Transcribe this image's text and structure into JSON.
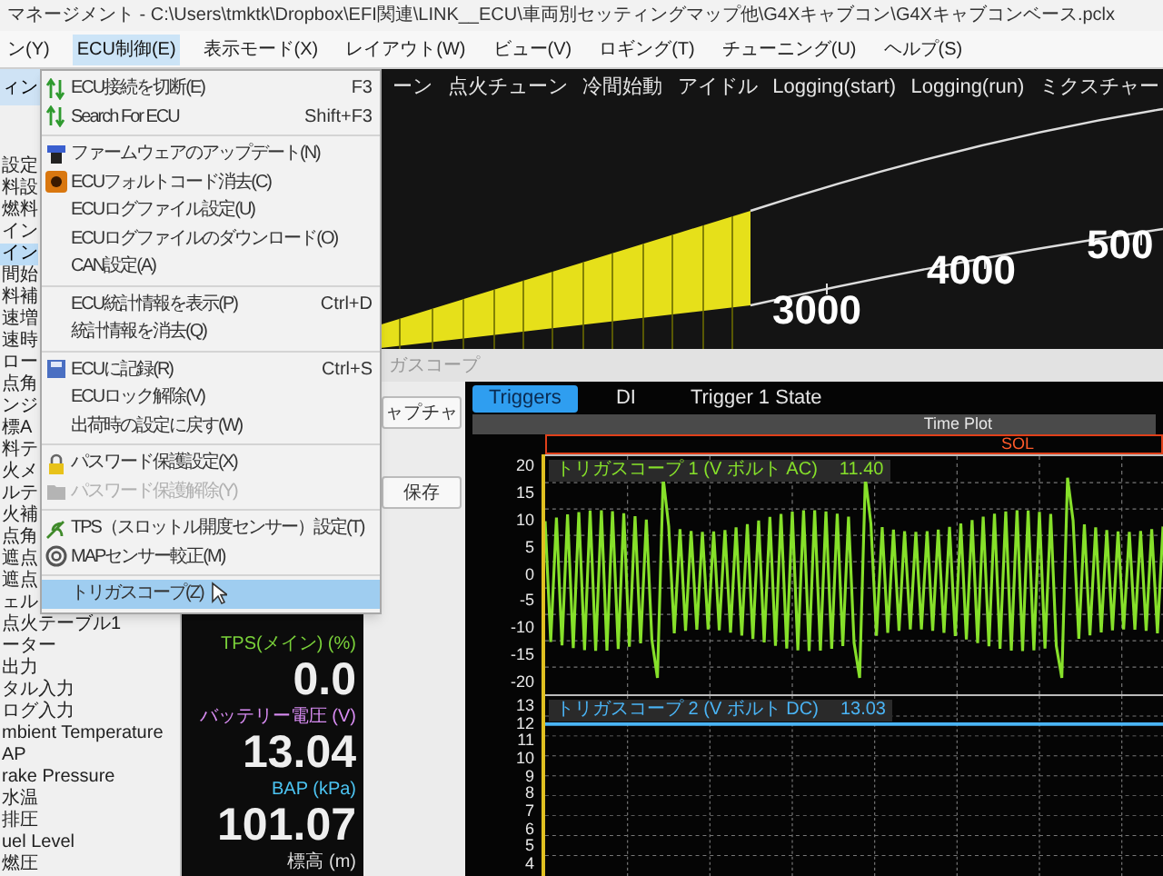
{
  "window": {
    "title": "マネージメント - C:\\Users\\tmktk\\Dropbox\\EFI関連\\LINK__ECU\\車両別セッティングマップ他\\G4Xキャブコン\\G4Xキャブコンベース.pclx"
  },
  "menu_bar": [
    {
      "label": "ン(Y)",
      "selected": false
    },
    {
      "label": "ECU制御(E)",
      "selected": true
    },
    {
      "label": "表示モード(X)",
      "selected": false
    },
    {
      "label": "レイアウト(W)",
      "selected": false
    },
    {
      "label": "ビュー(V)",
      "selected": false
    },
    {
      "label": "ロギング(T)",
      "selected": false
    },
    {
      "label": "チューニング(U)",
      "selected": false
    },
    {
      "label": "ヘルプ(S)",
      "selected": false
    }
  ],
  "dropdown_menu": {
    "groups": [
      [
        {
          "label": "ECU接続を切断(E)",
          "shortcut": "F3",
          "disabled": false,
          "selected": false
        },
        {
          "label": "Search For ECU",
          "shortcut": "Shift+F3",
          "disabled": false,
          "selected": false
        }
      ],
      [
        {
          "label": "ファームウェアのアップデート(N)",
          "disabled": false,
          "selected": false
        },
        {
          "label": "ECUフォルトコード消去(C)",
          "disabled": false,
          "selected": false
        },
        {
          "label": "ECUログファイル設定(U)",
          "disabled": false,
          "selected": false
        },
        {
          "label": "ECUログファイルのダウンロード(O)",
          "disabled": false,
          "selected": false
        },
        {
          "label": "CAN設定(A)",
          "disabled": false,
          "selected": false
        }
      ],
      [
        {
          "label": "ECU統計情報を表示(P)",
          "shortcut": "Ctrl+D",
          "disabled": false,
          "selected": false
        },
        {
          "label": "統計情報を消去(Q)",
          "disabled": false,
          "selected": false
        }
      ],
      [
        {
          "label": "ECUに記録(R)",
          "shortcut": "Ctrl+S",
          "disabled": false,
          "selected": false
        },
        {
          "label": "ECUロック解除(V)",
          "disabled": false,
          "selected": false
        },
        {
          "label": "出荷時の設定に戻す(W)",
          "disabled": false,
          "selected": false
        }
      ],
      [
        {
          "label": "パスワード保護設定(X)",
          "disabled": false,
          "selected": false
        },
        {
          "label": "パスワード保護解除(Y)",
          "disabled": true,
          "selected": false
        }
      ],
      [
        {
          "label": "TPS（スロットル開度センサー）設定(T)",
          "disabled": false,
          "selected": false
        },
        {
          "label": "MAPセンサー較正(M)",
          "disabled": false,
          "selected": false
        }
      ],
      [
        {
          "label": "トリガスコープ(Z)",
          "disabled": false,
          "selected": true
        }
      ]
    ]
  },
  "sidebar": {
    "tab": "ィン",
    "items": [
      {
        "label": "設定",
        "selected": false
      },
      {
        "label": "料設",
        "selected": false
      },
      {
        "label": "燃料",
        "selected": false
      },
      {
        "label": "イン",
        "selected": false
      },
      {
        "label": "イン",
        "selected": true
      },
      {
        "label": "間始",
        "selected": false
      },
      {
        "label": "料補",
        "selected": false
      },
      {
        "label": "速増",
        "selected": false
      },
      {
        "label": "速時",
        "selected": false
      },
      {
        "label": "ロー",
        "selected": false
      },
      {
        "label": "点角",
        "selected": false
      },
      {
        "label": "ンジ",
        "selected": false
      },
      {
        "label": "標A",
        "selected": false
      },
      {
        "label": "料テ",
        "selected": false
      },
      {
        "label": "火メ",
        "selected": false
      },
      {
        "label": "ルテ",
        "selected": false
      },
      {
        "label": "火補",
        "selected": false
      },
      {
        "label": "点角",
        "selected": false
      },
      {
        "label": "遮点",
        "selected": false
      },
      {
        "label": "遮点",
        "selected": false
      },
      {
        "label": "ェル",
        "selected": false
      },
      {
        "label": "点火テーブル1",
        "selected": false
      },
      {
        "label": "ーター",
        "selected": false
      },
      {
        "label": "出力",
        "selected": false
      },
      {
        "label": "タル入力",
        "selected": false
      },
      {
        "label": "ログ入力",
        "selected": false
      },
      {
        "label": "mbient Temperature",
        "selected": false
      },
      {
        "label": "AP",
        "selected": false
      },
      {
        "label": "rake Pressure",
        "selected": false
      },
      {
        "label": "水温",
        "selected": false
      },
      {
        "label": "排圧",
        "selected": false
      },
      {
        "label": "uel Level",
        "selected": false
      },
      {
        "label": "燃圧",
        "selected": false
      }
    ]
  },
  "gauges": [
    {
      "label": "TPS(メイン) (%)",
      "value": "0.0",
      "color": "#7ad13a"
    },
    {
      "label": "バッテリー電圧 (V)",
      "value": "13.04",
      "color": "#d88cf2"
    },
    {
      "label": "BAP (kPa)",
      "value": "101.07",
      "color": "#4cc4f2"
    },
    {
      "label": "標高 (m)",
      "color": "#dddddd"
    }
  ],
  "tuning_tabs": [
    "ーン",
    "点火チューン",
    "冷間始動",
    "アイドル",
    "Logging(start)",
    "Logging(run)",
    "ミクスチャー"
  ],
  "rpm_gauge": {
    "scale_labels": [
      "3000",
      "4000",
      "500"
    ]
  },
  "scope_window": {
    "title": "ガスコープ",
    "buttons": [
      "ャプチャ",
      "保存"
    ],
    "tabs": [
      {
        "label": "Triggers",
        "selected": true
      },
      {
        "label": "DI",
        "selected": false
      },
      {
        "label": "Trigger 1 State",
        "selected": false
      }
    ],
    "plot_title": "Time Plot",
    "channel_bar": "SOL",
    "plots": [
      {
        "name": "トリガスコープ 1 (V ボルト AC)",
        "reading": "11.40",
        "color": "#86e02a",
        "yticks": [
          "20",
          "15",
          "10",
          "5",
          "0",
          "-5",
          "-10",
          "-15",
          "-20"
        ]
      },
      {
        "name": "トリガスコープ 2 (V ボルト DC)",
        "reading": "13.03",
        "color": "#4ab4f5",
        "yticks": [
          "13",
          "12",
          "11",
          "10",
          "9",
          "8",
          "7",
          "6",
          "5",
          "4"
        ]
      }
    ]
  }
}
